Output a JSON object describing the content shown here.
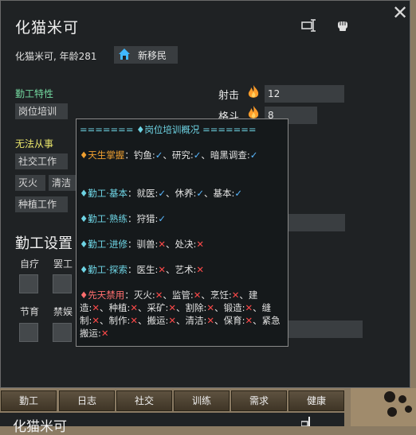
{
  "pawn": {
    "name": "化猫米可",
    "subtitle": "化猫米可, 年龄281",
    "faction": "新移民"
  },
  "traits": {
    "section_title": "勤工特性",
    "tag": "岗位培训"
  },
  "incapable": {
    "section_title": "无法从事",
    "tags": [
      "社交工作",
      "灭火",
      "清洁",
      "种植工作"
    ]
  },
  "skills": [
    {
      "label": "射击",
      "value": "12"
    },
    {
      "label": "格斗",
      "value": "8"
    }
  ],
  "work_settings": {
    "title": "勤工设置",
    "policies": [
      "自疗",
      "罢工",
      "节育",
      "禁娱"
    ]
  },
  "tooltip": {
    "header": "======= ♦岗位培训概况 =======",
    "talent": {
      "label": "♦天生掌握",
      "sep": "：",
      "content": "钓鱼:✓、研究:✓、暗黑调查:✓"
    },
    "basic": {
      "label": "♦勤工·基本",
      "sep": "：",
      "content": "就医:✓、休养:✓、基本:✓"
    },
    "skilled": {
      "label": "♦勤工·熟练",
      "sep": "：",
      "content": "狩猎:✓"
    },
    "advanced": {
      "label": "♦勤工·进修",
      "sep": "：",
      "content": "驯兽:✕、处决:✕"
    },
    "explore": {
      "label": "♦勤工·探索",
      "sep": "：",
      "content": "医生:✕、艺术:✕"
    },
    "forbidden": {
      "label": "♦先天禁用",
      "sep": "：",
      "content": "灭火:✕、监管:✕、烹饪:✕、建造:✕、种植:✕、采矿:✕、割除:✕、锻造:✕、缝制:✕、制作:✕、搬运:✕、清洁:✕、保育:✕、紧急搬运:✕"
    }
  },
  "tabs": [
    "勤工",
    "日志",
    "社交",
    "训练",
    "需求",
    "健康"
  ],
  "bottom": {
    "name": "化猫米可"
  },
  "icons": {
    "close": "close-icon",
    "rename": "rename-icon",
    "banish": "fist-icon",
    "faction": "house-icon",
    "passion": "flame-icon"
  },
  "colors": {
    "panel_bg": "#1f2224",
    "section_green": "#74d9a0",
    "section_yellow": "#e8e46a",
    "check_blue": "#5ab8ff",
    "cross_red": "#ff4a4a"
  }
}
